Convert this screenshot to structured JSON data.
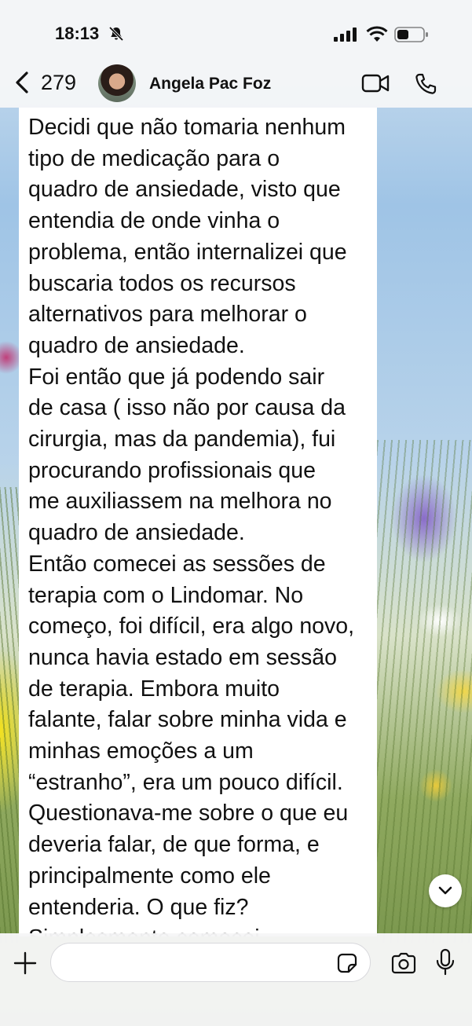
{
  "status_bar": {
    "time": "18:13",
    "icons": [
      "bell-slash-icon",
      "cellular-signal-icon",
      "wifi-icon",
      "battery-icon"
    ]
  },
  "chat_header": {
    "back_count": "279",
    "contact_name": "Angela Pac Foz",
    "icons": [
      "chevron-left-icon",
      "video-call-icon",
      "phone-call-icon"
    ]
  },
  "message": {
    "text": "Decidi que não tomaria nenhum\ntipo de medicação para o\nquadro de ansiedade, visto que\nentendia de onde vinha o\nproblema, então internalizei que\nbuscaria todos os recursos\nalternativos para melhorar o\nquadro de ansiedade.\nFoi então que já podendo sair\nde casa ( isso não por causa da\ncirurgia, mas da pandemia), fui\nprocurando profissionais que\nme auxiliassem na melhora no\nquadro de ansiedade.\nEntão comecei as sessões de\nterapia com o Lindomar. No\ncomeço, foi difícil, era algo novo,\nnunca havia estado em sessão\nde terapia. Embora muito\nfalante, falar sobre  minha vida e\nminhas emoções a um\n“estranho”, era um pouco difícil.\nQuestionava-me sobre o que eu\ndeveria falar, de que forma, e\nprincipalmente como ele\nentenderia. O que fiz?\nSimplesmente comecei"
  },
  "composer": {
    "input_value": "",
    "icons": [
      "plus-icon",
      "sticker-icon",
      "camera-icon",
      "microphone-icon",
      "chevron-down-icon"
    ]
  }
}
